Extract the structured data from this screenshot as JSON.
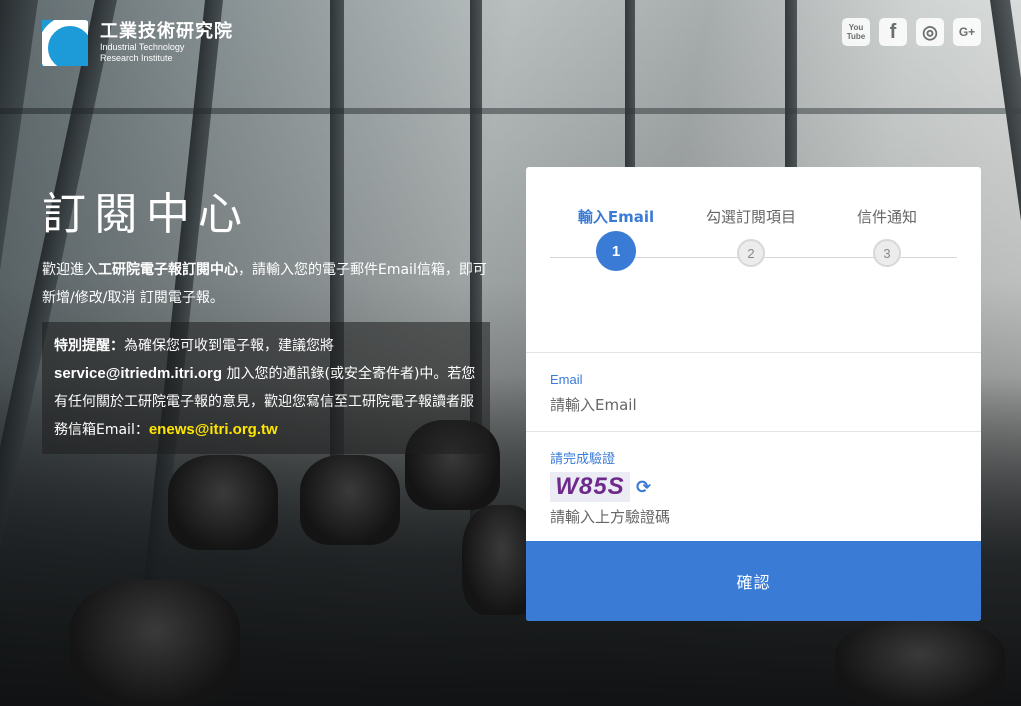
{
  "brand": {
    "name_cn": "工業技術研究院",
    "name_en_line1": "Industrial Technology",
    "name_en_line2": "Research Institute"
  },
  "social": [
    {
      "name": "youtube-icon",
      "glyph": "You\nTube"
    },
    {
      "name": "facebook-icon",
      "glyph": "f"
    },
    {
      "name": "instagram-icon",
      "glyph": "◎"
    },
    {
      "name": "google-plus-icon",
      "glyph": "G+"
    }
  ],
  "hero": {
    "title": "訂閱中心",
    "intro_pre": "歡迎進入",
    "intro_bold": "工研院電子報訂閱中心",
    "intro_post": "，請輸入您的電子郵件Email信箱，即可 新增/修改/取消 訂閱電子報。"
  },
  "notice": {
    "label": "特別提醒：",
    "text1": "為確保您可收到電子報，建議您將",
    "email": "service@itriedm.itri.org",
    "text2": " 加入您的通訊錄(或安全寄件者)中。若您有任何關於工研院電子報的意見，歡迎您寫信至工研院電子報讀者服務信箱Email：",
    "contact": "enews@itri.org.tw"
  },
  "steps": [
    {
      "label": "輸入Email",
      "number": "1",
      "active": true
    },
    {
      "label": "勾選訂閱項目",
      "number": "2",
      "active": false
    },
    {
      "label": "信件通知",
      "number": "3",
      "active": false
    }
  ],
  "form": {
    "email_label": "Email",
    "email_placeholder": "請輸入Email",
    "captcha_label": "請完成驗證",
    "captcha_text": "W85S",
    "captcha_placeholder": "請輸入上方驗證碼",
    "submit_label": "確認"
  },
  "colors": {
    "accent": "#3a7bd5",
    "highlight": "#ffe600",
    "logo": "#1d9bd8"
  }
}
